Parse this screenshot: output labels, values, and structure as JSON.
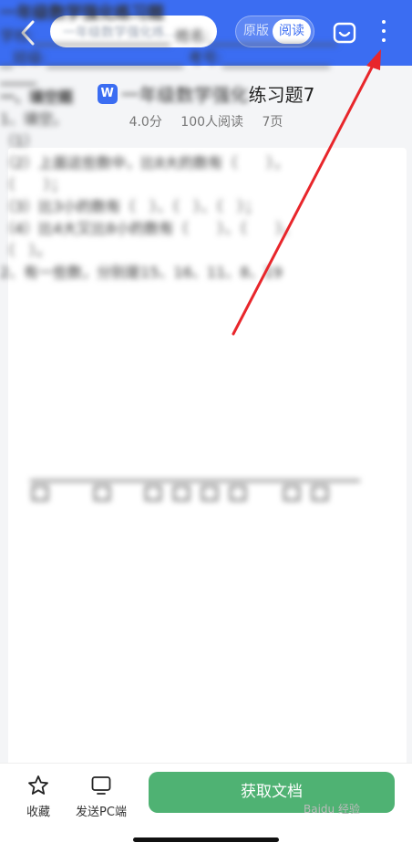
{
  "header": {
    "search_text": "一年级数学强化练...",
    "mode_original": "原版",
    "mode_read": "阅读",
    "icons": [
      "back-chevron-icon",
      "basket-icon",
      "more-vertical-icon"
    ],
    "bg_color": "#3b6df2"
  },
  "doc": {
    "type_badge": "W",
    "title_blurred": "一年级数学强化",
    "title_visible": "练习题7",
    "rating": "4.0分",
    "reads": "100人阅读",
    "pages": "7页"
  },
  "content": {
    "heading": "一年级数学强化练习题",
    "school": "学校:",
    "name": "姓名:",
    "class_label": "班级:",
    "exam_no": "考号:",
    "section1": "一、填空题",
    "q1": "1、填空。",
    "q1_1": "（1）",
    "q1_2a": "（2）上面这些数中，比8大的数有（　　），",
    "q1_2b": "（　　）；",
    "q1_3": "（3）比3小的数有（　）、（　）、（　）；",
    "q1_4a": "（4）比4大又比8小的数有（　　）、（　　）、",
    "q1_4b": "（　）。",
    "q2": "2、有一些数，分别是15、16、11、8、19"
  },
  "footer": {
    "favorite_label": "收藏",
    "send_pc_label": "发送PC端",
    "get_doc_label": "获取文档",
    "accent_color": "#4fb273",
    "watermark": "Baidu 经验"
  },
  "annotation": {
    "arrow_color": "#e8262b"
  }
}
